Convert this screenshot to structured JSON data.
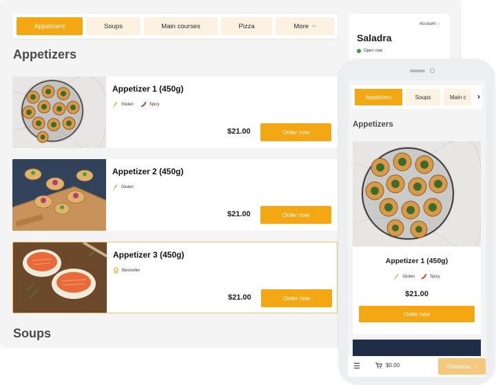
{
  "desktop": {
    "tabs": [
      {
        "label": "Appetizers",
        "active": true
      },
      {
        "label": "Soups",
        "active": false
      },
      {
        "label": "Main courses",
        "active": false
      },
      {
        "label": "Pizza",
        "active": false
      },
      {
        "label": "More",
        "active": false
      }
    ],
    "more_icon": "chevron-down-icon",
    "section_appetizers": "Appetizers",
    "section_soups": "Soups",
    "items": [
      {
        "name": "Appetizer 1 (450g)",
        "tags": [
          {
            "icon": "wheat-icon",
            "label": "Gluten"
          },
          {
            "icon": "chili-icon",
            "label": "Spicy"
          }
        ],
        "price": "$21.00",
        "button": "Order now"
      },
      {
        "name": "Appetizer 2 (450g)",
        "tags": [
          {
            "icon": "wheat-icon",
            "label": "Gluten"
          }
        ],
        "price": "$21.00",
        "button": "Order now"
      },
      {
        "name": "Appetizer 3 (450g)",
        "tags": [
          {
            "icon": "award-icon",
            "label": "Bestseller"
          }
        ],
        "price": "$21.00",
        "button": "Order now",
        "selected": true
      }
    ],
    "side": {
      "account": "Account",
      "restaurant_name": "Saladra",
      "status": "Open now"
    }
  },
  "mobile": {
    "tabs": [
      {
        "label": "Appetizers",
        "active": true
      },
      {
        "label": "Soups",
        "active": false
      },
      {
        "label": "Main c",
        "active": false
      }
    ],
    "scroll_icon": "chevron-right-icon",
    "section": "Appetizers",
    "item": {
      "name": "Appetizer 1 (450g)",
      "tags": [
        {
          "icon": "wheat-icon",
          "label": "Gluten"
        },
        {
          "icon": "chili-icon",
          "label": "Spicy"
        }
      ],
      "price": "$21.00",
      "button": "Order now"
    },
    "bottom": {
      "cart_total": "$0.00",
      "checkout": "Checkout"
    }
  },
  "colors": {
    "accent": "#f3a712",
    "tab_bg": "#fdf1e1",
    "page_bg": "#f4f4f4",
    "open_status": "#25a244"
  }
}
